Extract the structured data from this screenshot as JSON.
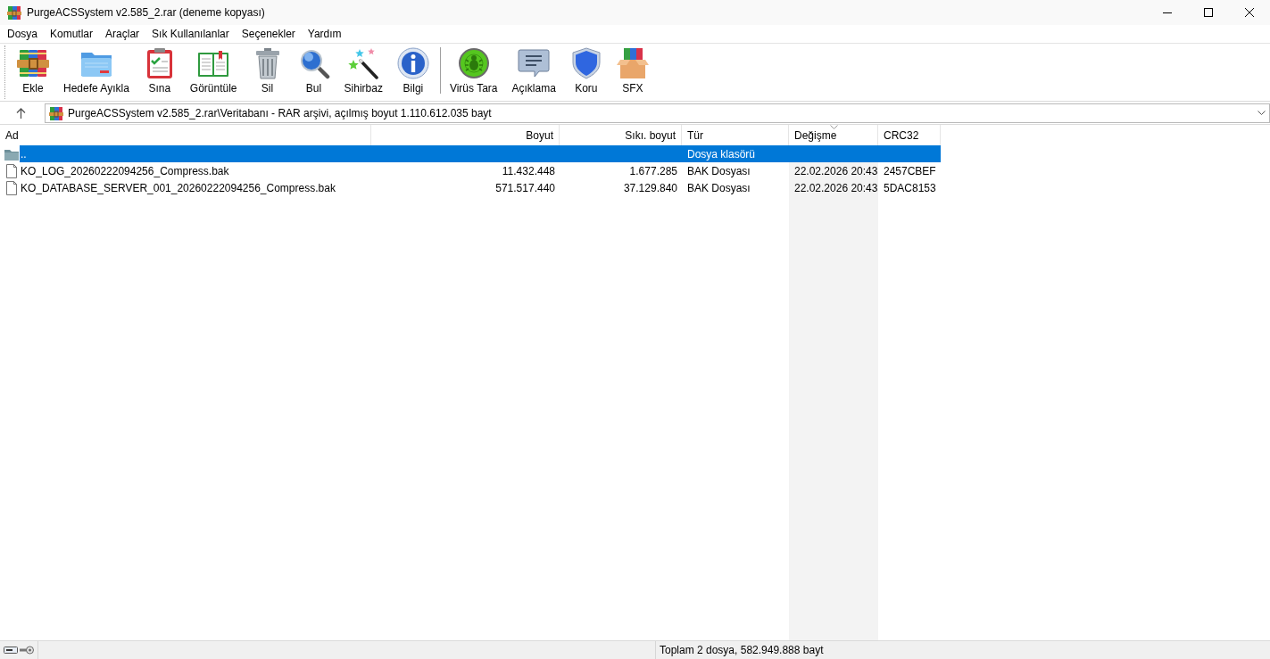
{
  "window": {
    "title": "PurgeACSSystem v2.585_2.rar (deneme kopyası)"
  },
  "menu": [
    "Dosya",
    "Komutlar",
    "Araçlar",
    "Sık Kullanılanlar",
    "Seçenekler",
    "Yardım"
  ],
  "toolbar": {
    "groups": [
      {
        "buttons": [
          {
            "kind": "add",
            "label": "Ekle"
          },
          {
            "kind": "extract",
            "label": "Hedefe Ayıkla"
          },
          {
            "kind": "test",
            "label": "Sına"
          },
          {
            "kind": "view",
            "label": "Görüntüle"
          },
          {
            "kind": "delete",
            "label": "Sil"
          },
          {
            "kind": "find",
            "label": "Bul"
          },
          {
            "kind": "wizard",
            "label": "Sihirbaz"
          },
          {
            "kind": "info",
            "label": "Bilgi"
          }
        ]
      },
      {
        "buttons": [
          {
            "kind": "virus",
            "label": "Virüs Tara"
          },
          {
            "kind": "comment",
            "label": "Açıklama"
          },
          {
            "kind": "protect",
            "label": "Koru"
          },
          {
            "kind": "sfx",
            "label": "SFX"
          }
        ]
      }
    ]
  },
  "address_bar": {
    "value": "PurgeACSSystem v2.585_2.rar\\Veritabanı - RAR arşivi, açılmış boyut 1.110.612.035 bayt"
  },
  "file_list": {
    "columns": [
      {
        "label": "Ad",
        "kind": "text",
        "sorted": false
      },
      {
        "label": "Boyut",
        "kind": "number",
        "sorted": false
      },
      {
        "label": "Sıkı. boyut",
        "kind": "number",
        "sorted": false
      },
      {
        "label": "Tür",
        "kind": "text",
        "sorted": false
      },
      {
        "label": "Değişme",
        "kind": "text",
        "sorted": true
      },
      {
        "label": "CRC32",
        "kind": "text",
        "sorted": false
      }
    ],
    "rows": [
      {
        "kind": "folder",
        "selected": true,
        "name": "..",
        "type": "Dosya klasörü"
      },
      {
        "kind": "file",
        "selected": false,
        "name": "KO_LOG_20260222094256_Compress.bak",
        "size": "11.432.448",
        "packed_size": "1.677.285",
        "type": "BAK Dosyası",
        "modified": "22.02.2026 20:43",
        "crc32": "2457CBEF"
      },
      {
        "kind": "file",
        "selected": false,
        "name": "KO_DATABASE_SERVER_001_20260222094256_Compress.bak",
        "size": "571.517.440",
        "packed_size": "37.129.840",
        "type": "BAK Dosyası",
        "modified": "22.02.2026 20:43",
        "crc32": "5DAC8153"
      }
    ]
  },
  "status_bar": {
    "text": "Toplam 2 dosya, 582.949.888 bayt"
  }
}
